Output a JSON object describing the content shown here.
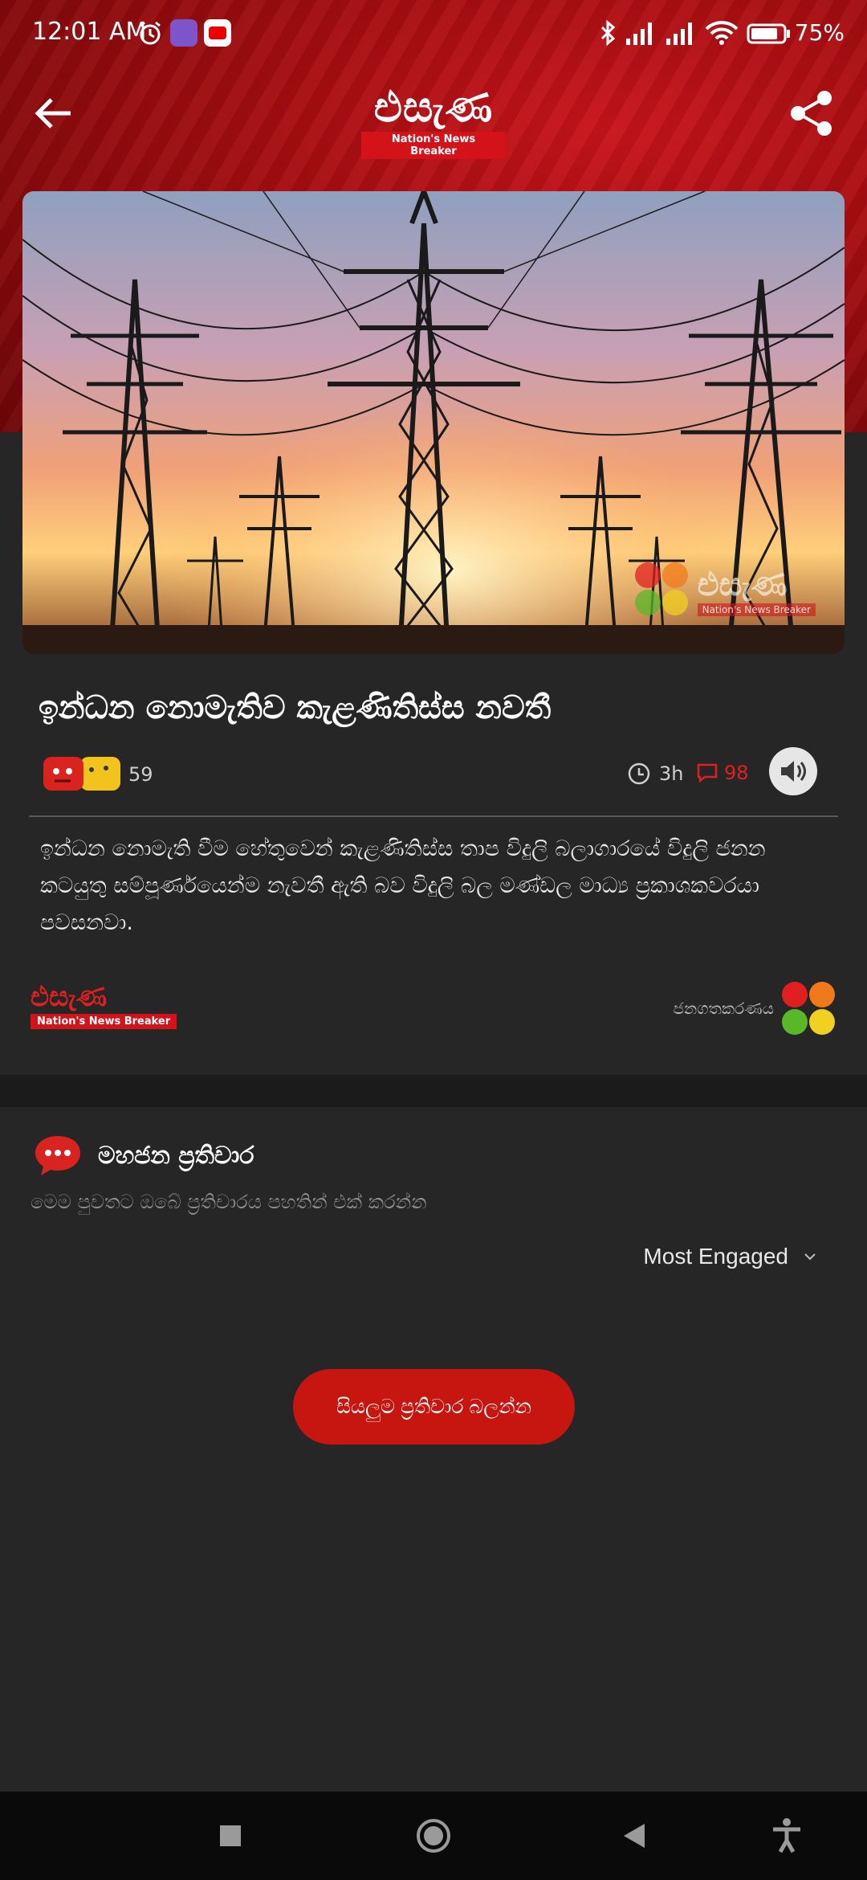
{
  "status_bar": {
    "time": "12:01 AM",
    "battery": "75%"
  },
  "app": {
    "logo_text": "එසැණ",
    "logo_tagline": "Nation's News Breaker"
  },
  "article": {
    "title": "ඉන්ධන නොමැතිව කැළණිතිස්ස නවතී",
    "reaction_count": "59",
    "time_ago": "3h",
    "comment_count": "98",
    "body": "ඉන්ධන නොමැති වීම හේතුවෙන් කැළණිතිස්ස තාප විදුලි බලාගාරයේ විදුලි ජනන කටයුතු සම්පූර්ණයෙන්ම නැවතී ඇති බව විදුලි බල මණ්ඩල මාධ්‍ය ප්‍රකාශකවරයා පවසනවා.",
    "source_logo_text": "එසැණ",
    "source_logo_tagline": "Nation's News Breaker",
    "popularize_label": "ජනගතකරණය",
    "image_watermark": "එසැණ",
    "image_watermark_tag": "Nation's News Breaker"
  },
  "comments": {
    "title": "මහජන ප්‍රතිචාර",
    "subtitle": "මෙම පුවතට ඔබේ ප්‍රතිචාරය පහතින් එක් කරන්න",
    "sort_selected": "Most Engaged",
    "view_all_label": "සියලුම ප්‍රතිචාර බලන්න"
  },
  "colors": {
    "accent": "#c7150f",
    "background": "#262626",
    "header": "#a40d10"
  },
  "icons": [
    "back-arrow-icon",
    "share-icon",
    "clock-icon",
    "comment-icon",
    "speaker-icon",
    "chat-bubble-icon",
    "chevron-down-icon",
    "stop-icon",
    "home-icon",
    "back-triangle-icon",
    "accessibility-icon"
  ]
}
